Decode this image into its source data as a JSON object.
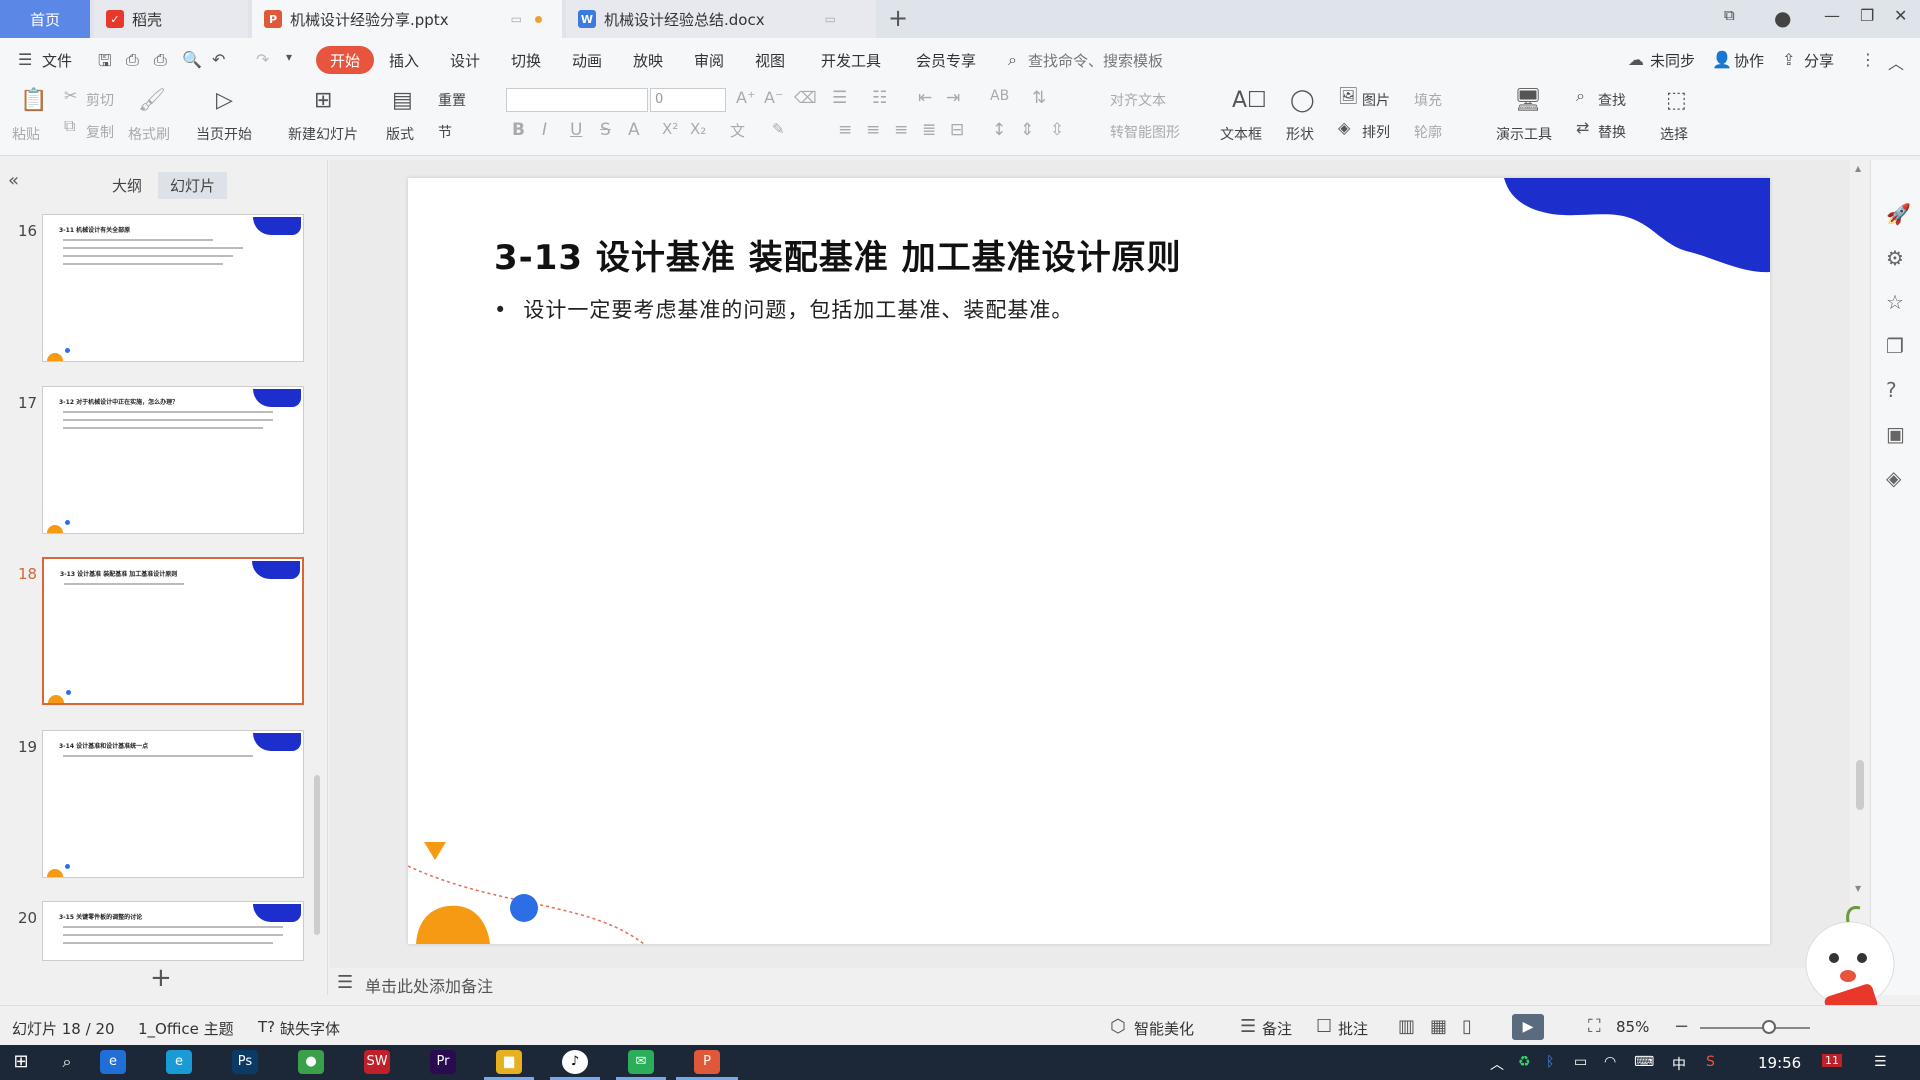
{
  "tabs": {
    "home": "首页",
    "daoke": "稻壳",
    "pptx": "机械设计经验分享.pptx",
    "docx": "机械设计经验总结.docx",
    "add": "+"
  },
  "menu": {
    "file": "文件",
    "items": [
      "开始",
      "插入",
      "设计",
      "切换",
      "动画",
      "放映",
      "审阅",
      "视图",
      "开发工具",
      "会员专享"
    ],
    "search": "查找命令、搜索模板",
    "sync": "未同步",
    "collab": "协作",
    "share": "分享"
  },
  "ribbon": {
    "paste": "粘贴",
    "cut": "剪切",
    "copy": "复制",
    "format_painter": "格式刷",
    "from_current": "当页开始",
    "new_slide": "新建幻灯片",
    "layout": "版式",
    "reset": "重置",
    "section": "节",
    "font_size": "0",
    "align_text": "对齐文本",
    "smart_shape": "转智能图形",
    "textbox": "文本框",
    "shape": "形状",
    "picture": "图片",
    "arrange": "排列",
    "fill": "填充",
    "outline": "轮廓",
    "present_tools": "演示工具",
    "find": "查找",
    "replace": "替换",
    "select": "选择"
  },
  "panel": {
    "outline_tab": "大纲",
    "slides_tab": "幻灯片",
    "thumbs": [
      {
        "num": "16",
        "title": "3-11 机械设计有关全部原"
      },
      {
        "num": "17",
        "title": "3-12 对于机械设计中正在实施，怎么办理？"
      },
      {
        "num": "18",
        "title": "3-13 设计基准 装配基准 加工基准设计原则"
      },
      {
        "num": "19",
        "title": "3-14 设计基准和设计基准统一点"
      },
      {
        "num": "20",
        "title": "3-15 关键零件板的调整的讨论"
      }
    ]
  },
  "slide": {
    "title": "3-13 设计基准 装配基准 加工基准设计原则",
    "bullet": "设计一定要考虑基准的问题，包括加工基准、装配基准。"
  },
  "notes": {
    "placeholder": "单击此处添加备注"
  },
  "status": {
    "slide_count": "幻灯片 18 / 20",
    "theme": "1_Office 主题",
    "missing_font": "缺失字体",
    "beautify": "智能美化",
    "notes": "备注",
    "comment": "批注",
    "zoom": "85%"
  },
  "taskbar": {
    "time": "19:56",
    "ime": "中",
    "notif_count": "11"
  },
  "colors": {
    "accent": "#e8553f",
    "blob": "#1c2ecc",
    "orange": "#f59a12",
    "blue_dot": "#2c6ee6"
  }
}
